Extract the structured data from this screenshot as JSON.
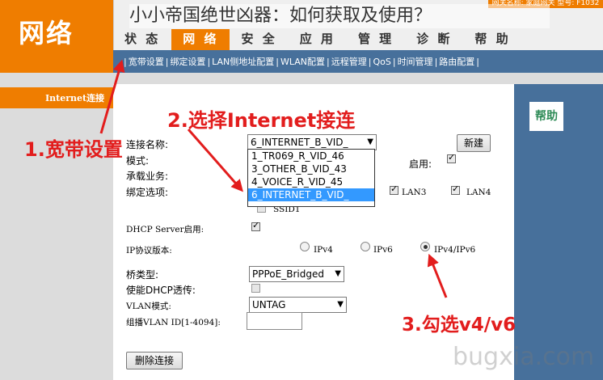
{
  "header": {
    "logo": "网络",
    "top_info": "网关名称: 家庭网关  型号: F1032",
    "overlay_title": "小小帝国绝世凶器：如何获取及使用？"
  },
  "nav": {
    "items": [
      {
        "label": "状 态"
      },
      {
        "label": "网 络"
      },
      {
        "label": "安 全"
      },
      {
        "label": "应 用"
      },
      {
        "label": "管 理"
      },
      {
        "label": "诊 断"
      },
      {
        "label": "帮 助"
      }
    ]
  },
  "subnav": {
    "items": [
      {
        "label": "宽带设置"
      },
      {
        "label": "绑定设置"
      },
      {
        "label": "LAN侧地址配置"
      },
      {
        "label": "WLAN配置"
      },
      {
        "label": "远程管理"
      },
      {
        "label": "QoS"
      },
      {
        "label": "时间管理"
      },
      {
        "label": "路由配置"
      }
    ]
  },
  "leftmenu": {
    "active_item": "Internet连接"
  },
  "help": {
    "label": "帮助"
  },
  "form": {
    "connection_name_label": "连接名称:",
    "connection_name_value": "6_INTERNET_B_VID_",
    "connection_options": [
      "1_TR069_R_VID_46",
      "3_OTHER_B_VID_43",
      "4_VOICE_R_VID_45",
      "6_INTERNET_B_VID_"
    ],
    "new_button": "新建",
    "mode_label": "模式:",
    "enable_label": "启用:",
    "service_label": "承载业务:",
    "bind_label": "绑定选项:",
    "lan3": "LAN3",
    "lan4": "LAN4",
    "ssid1": "SSID1",
    "dhcp_label": "DHCP Server启用:",
    "ip_version_label": "IP协议版本:",
    "ipv4": "IPv4",
    "ipv6": "IPv6",
    "ipv4v6": "IPv4/IPv6",
    "bridge_type_label": "桥类型:",
    "bridge_type_value": "PPPoE_Bridged",
    "dhcp_passthrough_label": "使能DHCP透传:",
    "vlan_mode_label": "VLAN模式:",
    "vlan_mode_value": "UNTAG",
    "multicast_vlan_label": "组播VLAN ID[1-4094]:",
    "delete_button": "删除连接"
  },
  "annotations": {
    "step1": "1.宽带设置",
    "step2": "2.选择Internet接连",
    "step3": "3.勾选v4/v6"
  },
  "watermark": "bugxia.com",
  "colors": {
    "orange": "#ef7d00",
    "blue": "#47709b",
    "annotation_red": "#e21d1d",
    "selected_option": "#3399ff"
  }
}
